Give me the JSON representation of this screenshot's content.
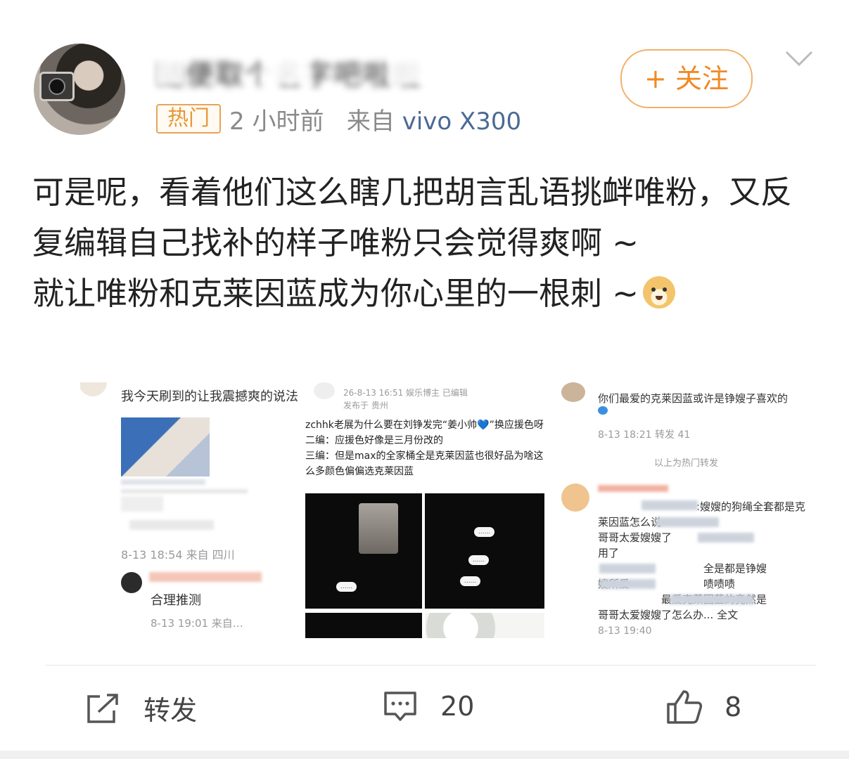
{
  "header": {
    "username": "随便取个名字吧啦啦",
    "hot_badge": "热门",
    "time": "2 小时前",
    "source_prefix": "来自",
    "source_device": "vivo X300",
    "follow_label": "+ 关注"
  },
  "post": {
    "line1": "可是呢，看着他们这么瞎几把胡言乱语挑衅唯粉，又反复编辑自己找补的样子唯粉只会觉得爽啊 ~",
    "line2": "就让唯粉和克莱因蓝成为你心里的一根刺 ~"
  },
  "images": {
    "img1": {
      "caption": "我今天刷到的让我震撼爽的说法",
      "meta": "8-13 18:54  来自 四川",
      "reply": "合理推测",
      "reply_meta": "8-13 19:01  来自…"
    },
    "img2": {
      "date_line": "26-8-13 16:51  娱乐博主  已编辑",
      "loc_line": "发布于 贵州",
      "text1": "zchhk老展为什么要在刘铮发完“姜小帅💙”换应援色呀",
      "text2": "二编：应援色好像是三月份改的",
      "text3": "三编：但是max的全家桶全是克莱因蓝也很好品为啥这么多颜色偏偏选克莱因蓝"
    },
    "img3": {
      "text1": "你们最爱的克莱因蓝或许是铮嫂子喜欢的",
      "meta1": "8-13 18:21  转发 41",
      "divider": "以上为热门转发",
      "c1": ":嫂嫂的狗绳全套都是克",
      "c2": "莱因蓝怎么说",
      "c3": "哥哥太爱嫂嫂了",
      "c4": "用了",
      "c5": "全是都是铮嫂",
      "c6": "嫂所爱",
      "c7": "啧啧啧",
      "c8": "最爱克莱因蓝的竟然是",
      "c9": "哥哥太爱嫂嫂了怎么办... 全文",
      "meta2": "8-13 19:40"
    }
  },
  "actions": {
    "repost_label": "转发",
    "comment_count": "20",
    "like_count": "8"
  },
  "colors": {
    "accent": "#f08a24",
    "link": "#4b6a94",
    "hot": "#e59838"
  }
}
